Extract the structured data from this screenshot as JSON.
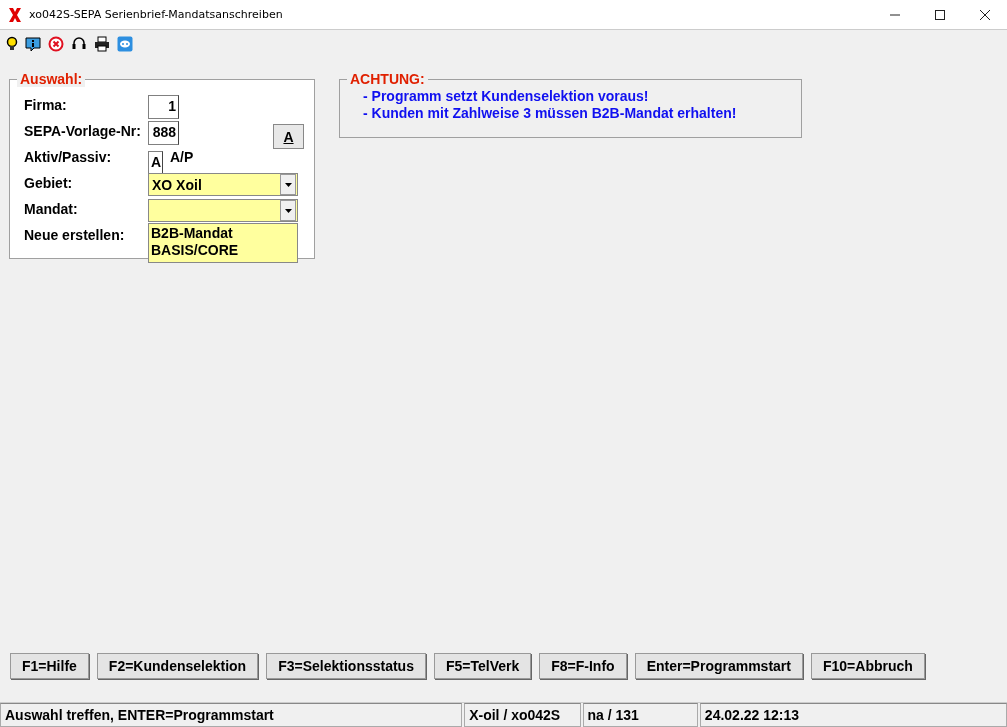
{
  "window": {
    "title": "xo042S-SEPA Serienbrief-Mandatsanschreiben"
  },
  "toolbar": [
    {
      "kind": "bulb"
    },
    {
      "kind": "info"
    },
    {
      "kind": "cancel"
    },
    {
      "kind": "headset"
    },
    {
      "kind": "print"
    },
    {
      "kind": "chat"
    }
  ],
  "selection_group": {
    "title": "Auswahl:",
    "fields": [
      {
        "kind": "text",
        "label": "Firma:",
        "value": "1"
      },
      {
        "kind": "text",
        "label": "SEPA-Vorlage-Nr:",
        "value": "888",
        "button": "A"
      },
      {
        "kind": "flag",
        "label": "Aktiv/Passiv:",
        "value": "A",
        "hint": "A/P"
      },
      {
        "kind": "combo",
        "label": "Gebiet:",
        "value": "XO Xoil"
      },
      {
        "kind": "combo",
        "label": "Mandat:",
        "options": [
          "B2B-Mandat",
          "BASIS/CORE"
        ]
      },
      {
        "kind": "label",
        "label": "Neue erstellen:"
      }
    ]
  },
  "notice_group": {
    "title": "ACHTUNG:",
    "lines": [
      "- Programm setzt Kundenselektion voraus!",
      "- Kunden mit Zahlweise 3 müssen B2B-Mandat erhalten!"
    ]
  },
  "function_keys": [
    "F1=Hilfe",
    "F2=Kundenselektion",
    "F3=Selektionsstatus",
    "F5=TelVerk",
    "F8=F-Info",
    "Enter=Programmstart",
    "F10=Abbruch"
  ],
  "status_bar": [
    "Auswahl treffen, ENTER=Programmstart",
    "X-oil / xo042S",
    "na / 131",
    "24.02.22 12:13"
  ]
}
